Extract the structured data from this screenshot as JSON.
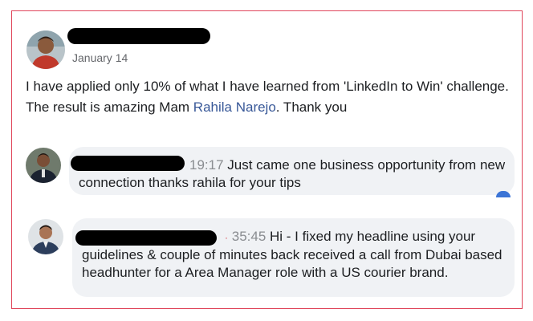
{
  "post": {
    "date": "January 14",
    "text_before": "I have applied only 10% of what I have learned from 'LinkedIn to Win' challenge. The result is amazing Mam ",
    "mention": "Rahila Narejo",
    "text_after": ". Thank you"
  },
  "comments": [
    {
      "time": "19:17",
      "text": "Just came one business opportunity from new connection thanks rahila for your tips"
    },
    {
      "separator": "·",
      "time": "35:45",
      "text": "Hi - I fixed my headline using your guidelines & couple of minutes back received a call from Dubai based headhunter for a Area Manager role with a US courier brand."
    }
  ],
  "colors": {
    "frame_border": "#e0455a",
    "mention": "#385898",
    "bubble": "#f0f2f5",
    "timestamp": "#8a8d91"
  }
}
